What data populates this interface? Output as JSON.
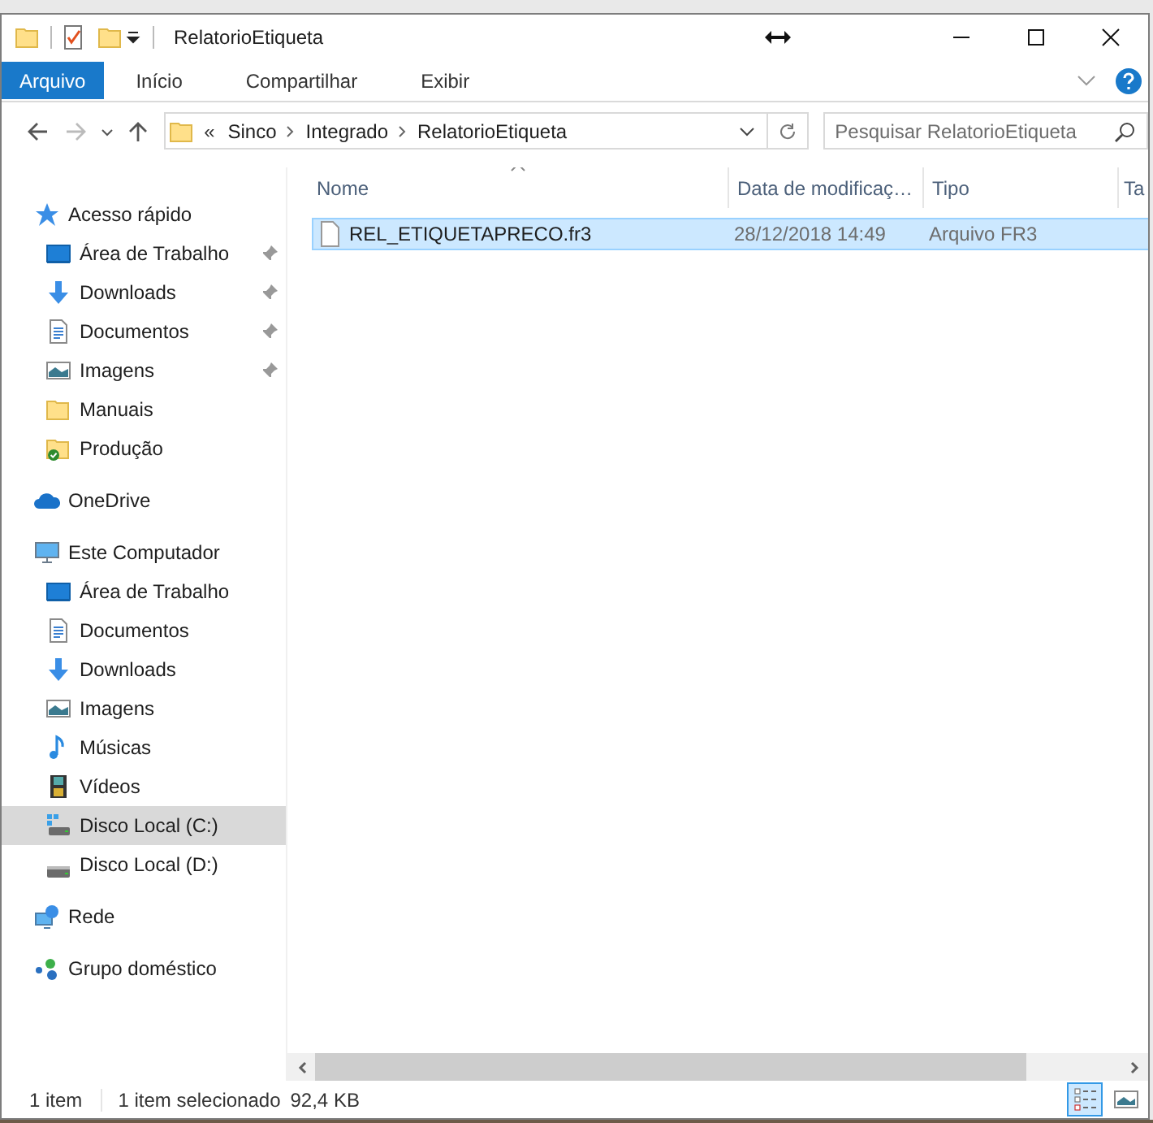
{
  "title_bar": {
    "title": "RelatorioEtiqueta"
  },
  "ribbon": {
    "tabs": [
      {
        "label": "Arquivo",
        "selected": true
      },
      {
        "label": "Início",
        "selected": false
      },
      {
        "label": "Compartilhar",
        "selected": false
      },
      {
        "label": "Exibir",
        "selected": false
      }
    ]
  },
  "navigation": {
    "back_disabled": false,
    "forward_disabled": true
  },
  "address_bar": {
    "overflow": "«",
    "path": [
      "Sinco",
      "Integrado",
      "RelatorioEtiqueta"
    ],
    "search": {
      "placeholder": "Pesquisar RelatorioEtiqueta"
    }
  },
  "sidebar": {
    "sections": [
      {
        "label": "Acesso rápido",
        "selected": false,
        "children": [
          {
            "label": "Área de Trabalho",
            "pinned": true,
            "selected": false
          },
          {
            "label": "Downloads",
            "pinned": true,
            "selected": false
          },
          {
            "label": "Documentos",
            "pinned": true,
            "selected": false
          },
          {
            "label": "Imagens",
            "pinned": true,
            "selected": false
          },
          {
            "label": "Manuais",
            "pinned": false,
            "selected": false
          },
          {
            "label": "Produção",
            "pinned": false,
            "selected": false
          }
        ]
      },
      {
        "label": "OneDrive",
        "selected": false
      },
      {
        "label": "Este Computador",
        "selected": false,
        "children": [
          {
            "label": "Área de Trabalho",
            "pinned": false,
            "selected": false
          },
          {
            "label": "Documentos",
            "pinned": false,
            "selected": false
          },
          {
            "label": "Downloads",
            "pinned": false,
            "selected": false
          },
          {
            "label": "Imagens",
            "pinned": false,
            "selected": false
          },
          {
            "label": "Músicas",
            "pinned": false,
            "selected": false
          },
          {
            "label": "Vídeos",
            "pinned": false,
            "selected": false
          },
          {
            "label": "Disco Local (C:)",
            "pinned": false,
            "selected": true
          },
          {
            "label": "Disco Local (D:)",
            "pinned": false,
            "selected": false
          }
        ]
      },
      {
        "label": "Rede",
        "selected": false
      },
      {
        "label": "Grupo doméstico",
        "selected": false
      }
    ]
  },
  "file_list": {
    "columns": [
      {
        "label": "Nome",
        "sorted": true
      },
      {
        "label": "Data de modificaç…",
        "sorted": false
      },
      {
        "label": "Tipo",
        "sorted": false
      },
      {
        "label": "Ta",
        "sorted": false
      }
    ],
    "rows": [
      {
        "name": "REL_ETIQUETAPRECO.fr3",
        "modified": "28/12/2018 14:49",
        "type": "Arquivo FR3",
        "selected": true
      }
    ]
  },
  "status_bar": {
    "item_count": "1 item",
    "selection": "1 item selecionado",
    "size": "92,4 KB",
    "views": [
      {
        "kind": "details",
        "selected": true
      },
      {
        "kind": "large-icons",
        "selected": false
      }
    ]
  }
}
